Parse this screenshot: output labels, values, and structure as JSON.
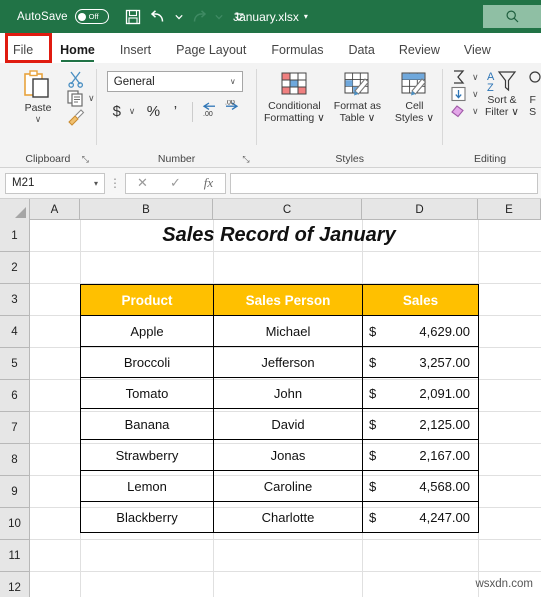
{
  "titlebar": {
    "autosave_label": "AutoSave",
    "autosave_state": "Off",
    "save_icon": "save-icon",
    "undo_icon": "undo-icon",
    "redo_icon": "redo-icon",
    "customize_qat_icon": "customize-quick-access-toolbar-icon",
    "document_title": "January.xlsx",
    "title_caret": "▾",
    "search_icon": "search-icon",
    "background_color": "#217346"
  },
  "tabs": [
    {
      "label": "File",
      "active": false,
      "highlighted": true
    },
    {
      "label": "Home",
      "active": true,
      "highlighted": false
    },
    {
      "label": "Insert",
      "active": false,
      "highlighted": false
    },
    {
      "label": "Page Layout",
      "active": false,
      "highlighted": false
    },
    {
      "label": "Formulas",
      "active": false,
      "highlighted": false
    },
    {
      "label": "Data",
      "active": false,
      "highlighted": false
    },
    {
      "label": "Review",
      "active": false,
      "highlighted": false
    },
    {
      "label": "View",
      "active": false,
      "highlighted": false
    }
  ],
  "highlight": {
    "color": "#e01b10",
    "target": "File"
  },
  "ribbon": {
    "clipboard": {
      "label": "Clipboard",
      "paste_label": "Paste",
      "paste_caret": "∨",
      "cut_icon": "scissors-icon",
      "copy_icon": "copy-icon",
      "copy_caret": "∨",
      "format_painter_icon": "format-painter-icon",
      "dialog_launcher": "⤡"
    },
    "number": {
      "label": "Number",
      "format_value": "General",
      "format_caret": "∨",
      "currency_label": "$",
      "currency_caret": "∨",
      "percent_label": "%",
      "comma_label": "’",
      "increase_decimal_icon": "increase-decimal-icon",
      "decrease_decimal_icon": "decrease-decimal-icon",
      "dialog_launcher": "⤡"
    },
    "styles": {
      "label": "Styles",
      "conditional_formatting_label": "Conditional\nFormatting",
      "conditional_formatting_line1": "Conditional",
      "conditional_formatting_line2": "Formatting ∨",
      "format_as_table_line1": "Format as",
      "format_as_table_line2": "Table ∨",
      "cell_styles_line1": "Cell",
      "cell_styles_line2": "Styles ∨"
    },
    "editing": {
      "label": "Editing",
      "autosum_icon": "autosum-sigma-icon",
      "autosum_caret": "∨",
      "fill_icon": "fill-down-icon",
      "fill_caret": "∨",
      "clear_icon": "clear-eraser-icon",
      "clear_caret": "∨",
      "sort_filter_line1": "Sort &",
      "sort_filter_line2": "Filter ∨",
      "find_select_line1": "F",
      "find_select_line2": "S"
    }
  },
  "formulabar": {
    "name_box_value": "M21",
    "name_box_caret": "▾",
    "cancel_icon": "cancel-x-icon",
    "enter_icon": "enter-check-icon",
    "function_icon": "fx",
    "formula_value": ""
  },
  "grid": {
    "columns": [
      "A",
      "B",
      "C",
      "D",
      "E"
    ],
    "rows": [
      "1",
      "2",
      "3",
      "4",
      "5",
      "6",
      "7",
      "8",
      "9",
      "10",
      "11",
      "12"
    ],
    "sheet_title": "Sales Record of January"
  },
  "table": {
    "headers": [
      "Product",
      "Sales Person",
      "Sales"
    ],
    "header_bg": "#ffc000",
    "header_color": "#ffffff",
    "rows": [
      {
        "product": "Apple",
        "person": "Michael",
        "currency": "$",
        "amount": "4,629.00"
      },
      {
        "product": "Broccoli",
        "person": "Jefferson",
        "currency": "$",
        "amount": "3,257.00"
      },
      {
        "product": "Tomato",
        "person": "John",
        "currency": "$",
        "amount": "2,091.00"
      },
      {
        "product": "Banana",
        "person": "David",
        "currency": "$",
        "amount": "2,125.00"
      },
      {
        "product": "Strawberry",
        "person": "Jonas",
        "currency": "$",
        "amount": "2,167.00"
      },
      {
        "product": "Lemon",
        "person": "Caroline",
        "currency": "$",
        "amount": "4,568.00"
      },
      {
        "product": "Blackberry",
        "person": "Charlotte",
        "currency": "$",
        "amount": "4,247.00"
      }
    ]
  },
  "watermark": {
    "text": "wsxdn.com"
  }
}
